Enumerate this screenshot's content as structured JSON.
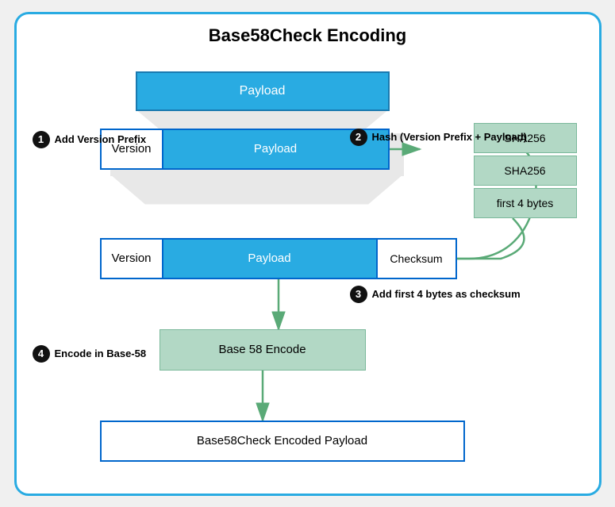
{
  "title": "Base58Check Encoding",
  "steps": [
    {
      "number": "1",
      "label": "Add Version Prefix"
    },
    {
      "number": "2",
      "label": "Hash (Version Prefix + Payload)"
    },
    {
      "number": "3",
      "label": "Add first 4 bytes as checksum"
    },
    {
      "number": "4",
      "label": "Encode in Base-58"
    }
  ],
  "boxes": {
    "payload_top": "Payload",
    "version": "Version",
    "payload_mid": "Payload",
    "sha1": "SHA256",
    "sha2": "SHA256",
    "first_bytes": "first 4 bytes",
    "payload_lower": "Payload",
    "checksum": "Checksum",
    "base58_encode": "Base 58 Encode",
    "encoded_payload": "Base58Check Encoded Payload"
  }
}
